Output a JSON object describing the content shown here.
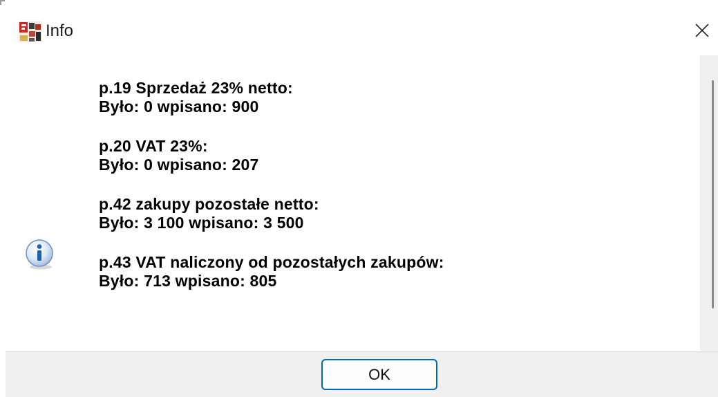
{
  "window": {
    "title": "Info",
    "app_icon": "frk-app-icon",
    "close_icon": "close-icon"
  },
  "dialog": {
    "icon": "info-icon",
    "messages": [
      {
        "label": "p.19 Sprzedaż 23% netto:",
        "change": "Było: 0 wpisano: 900"
      },
      {
        "label": "p.20 VAT 23%:",
        "change": "Było: 0 wpisano: 207"
      },
      {
        "label": "p.42 zakupy pozostałe netto:",
        "change": "Było: 3 100 wpisano: 3 500"
      },
      {
        "label": "p.43 VAT naliczony od pozostałych zakupów:",
        "change": "Było: 713 wpisano: 805"
      }
    ]
  },
  "buttons": {
    "ok_label": "OK"
  },
  "colors": {
    "accent": "#0067c0",
    "footer_bg": "#f0f0f0",
    "info_icon_blue": "#1c5fb5"
  }
}
